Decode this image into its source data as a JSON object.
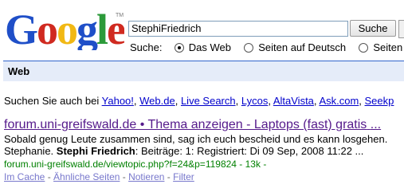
{
  "logo": {
    "text": "Google",
    "trademark": "TM"
  },
  "search": {
    "query": "StephiFriedrich",
    "button_label": "Suche"
  },
  "scope": {
    "label": "Suche:",
    "options": [
      {
        "label": "Das Web",
        "checked": true
      },
      {
        "label": "Seiten auf Deutsch",
        "checked": false
      },
      {
        "label": "Seiten au",
        "checked": false
      }
    ]
  },
  "tab": {
    "label": "Web"
  },
  "also": {
    "prefix": "Suchen Sie auch bei",
    "links": [
      "Yahoo!",
      "Web.de",
      "Live Search",
      "Lycos",
      "AltaVista",
      "Ask.com",
      "Seekp"
    ]
  },
  "result": {
    "title": "forum.uni-greifswald.de • Thema anzeigen - Laptops (fast) gratis",
    "title_ellipsis": "...",
    "snippet_line1": "Sobald genug Leute zusammen sind, sag ich euch bescheid und es kann losgehen.",
    "snippet_line2_prefix": "Stephanie. ",
    "snippet_line2_bold": "Stephi Friedrich",
    "snippet_line2_suffix": ": Beiträge: 1: Registriert: Di 09 Sep, 2008 11:22 ...",
    "url": "forum.uni-greifswald.de/viewtopic.php?f=24&p=119824 - 13k -",
    "cache_label": "Im Cache",
    "similar_label": "Ähnliche Seiten",
    "notes_label": "Notieren",
    "filter_label": "Filter",
    "separator": " - "
  }
}
